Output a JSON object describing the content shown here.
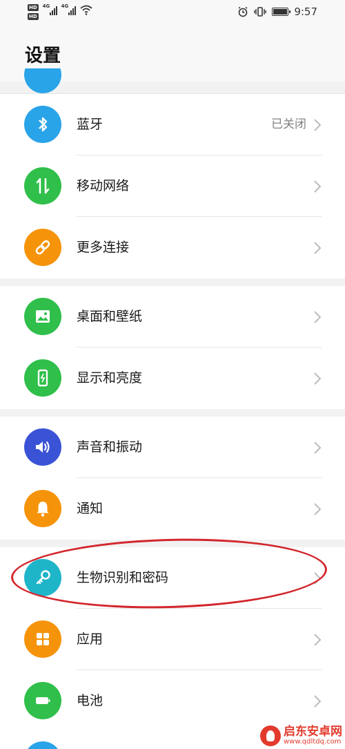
{
  "status_bar": {
    "hd_badges": [
      "HD",
      "HD"
    ],
    "network": [
      "4G",
      "4G"
    ],
    "time": "9:57"
  },
  "header": {
    "title": "设置"
  },
  "settings": [
    {
      "label": "蓝牙",
      "value": "已关闭",
      "icon": "bluetooth-icon",
      "color": "#2aa4e8"
    },
    {
      "label": "移动网络",
      "value": "",
      "icon": "mobile-data-icon",
      "color": "#2fbf4a"
    },
    {
      "label": "更多连接",
      "value": "",
      "icon": "link-icon",
      "color": "#f5930a"
    },
    {
      "label": "桌面和壁纸",
      "value": "",
      "icon": "wallpaper-icon",
      "color": "#2fbf4a"
    },
    {
      "label": "显示和亮度",
      "value": "",
      "icon": "display-icon",
      "color": "#2fbf4a"
    },
    {
      "label": "声音和振动",
      "value": "",
      "icon": "volume-icon",
      "color": "#3a53d6"
    },
    {
      "label": "通知",
      "value": "",
      "icon": "bell-icon",
      "color": "#f5930a"
    },
    {
      "label": "生物识别和密码",
      "value": "",
      "icon": "key-icon",
      "color": "#1fb5c9"
    },
    {
      "label": "应用",
      "value": "",
      "icon": "apps-icon",
      "color": "#f5930a"
    },
    {
      "label": "电池",
      "value": "",
      "icon": "battery-icon",
      "color": "#2fbf4a"
    }
  ],
  "annotation": {
    "color": "#d3262d",
    "target": "生物识别和密码"
  },
  "watermark": {
    "name": "启东安卓网",
    "url": "www.qdltdq.com"
  }
}
